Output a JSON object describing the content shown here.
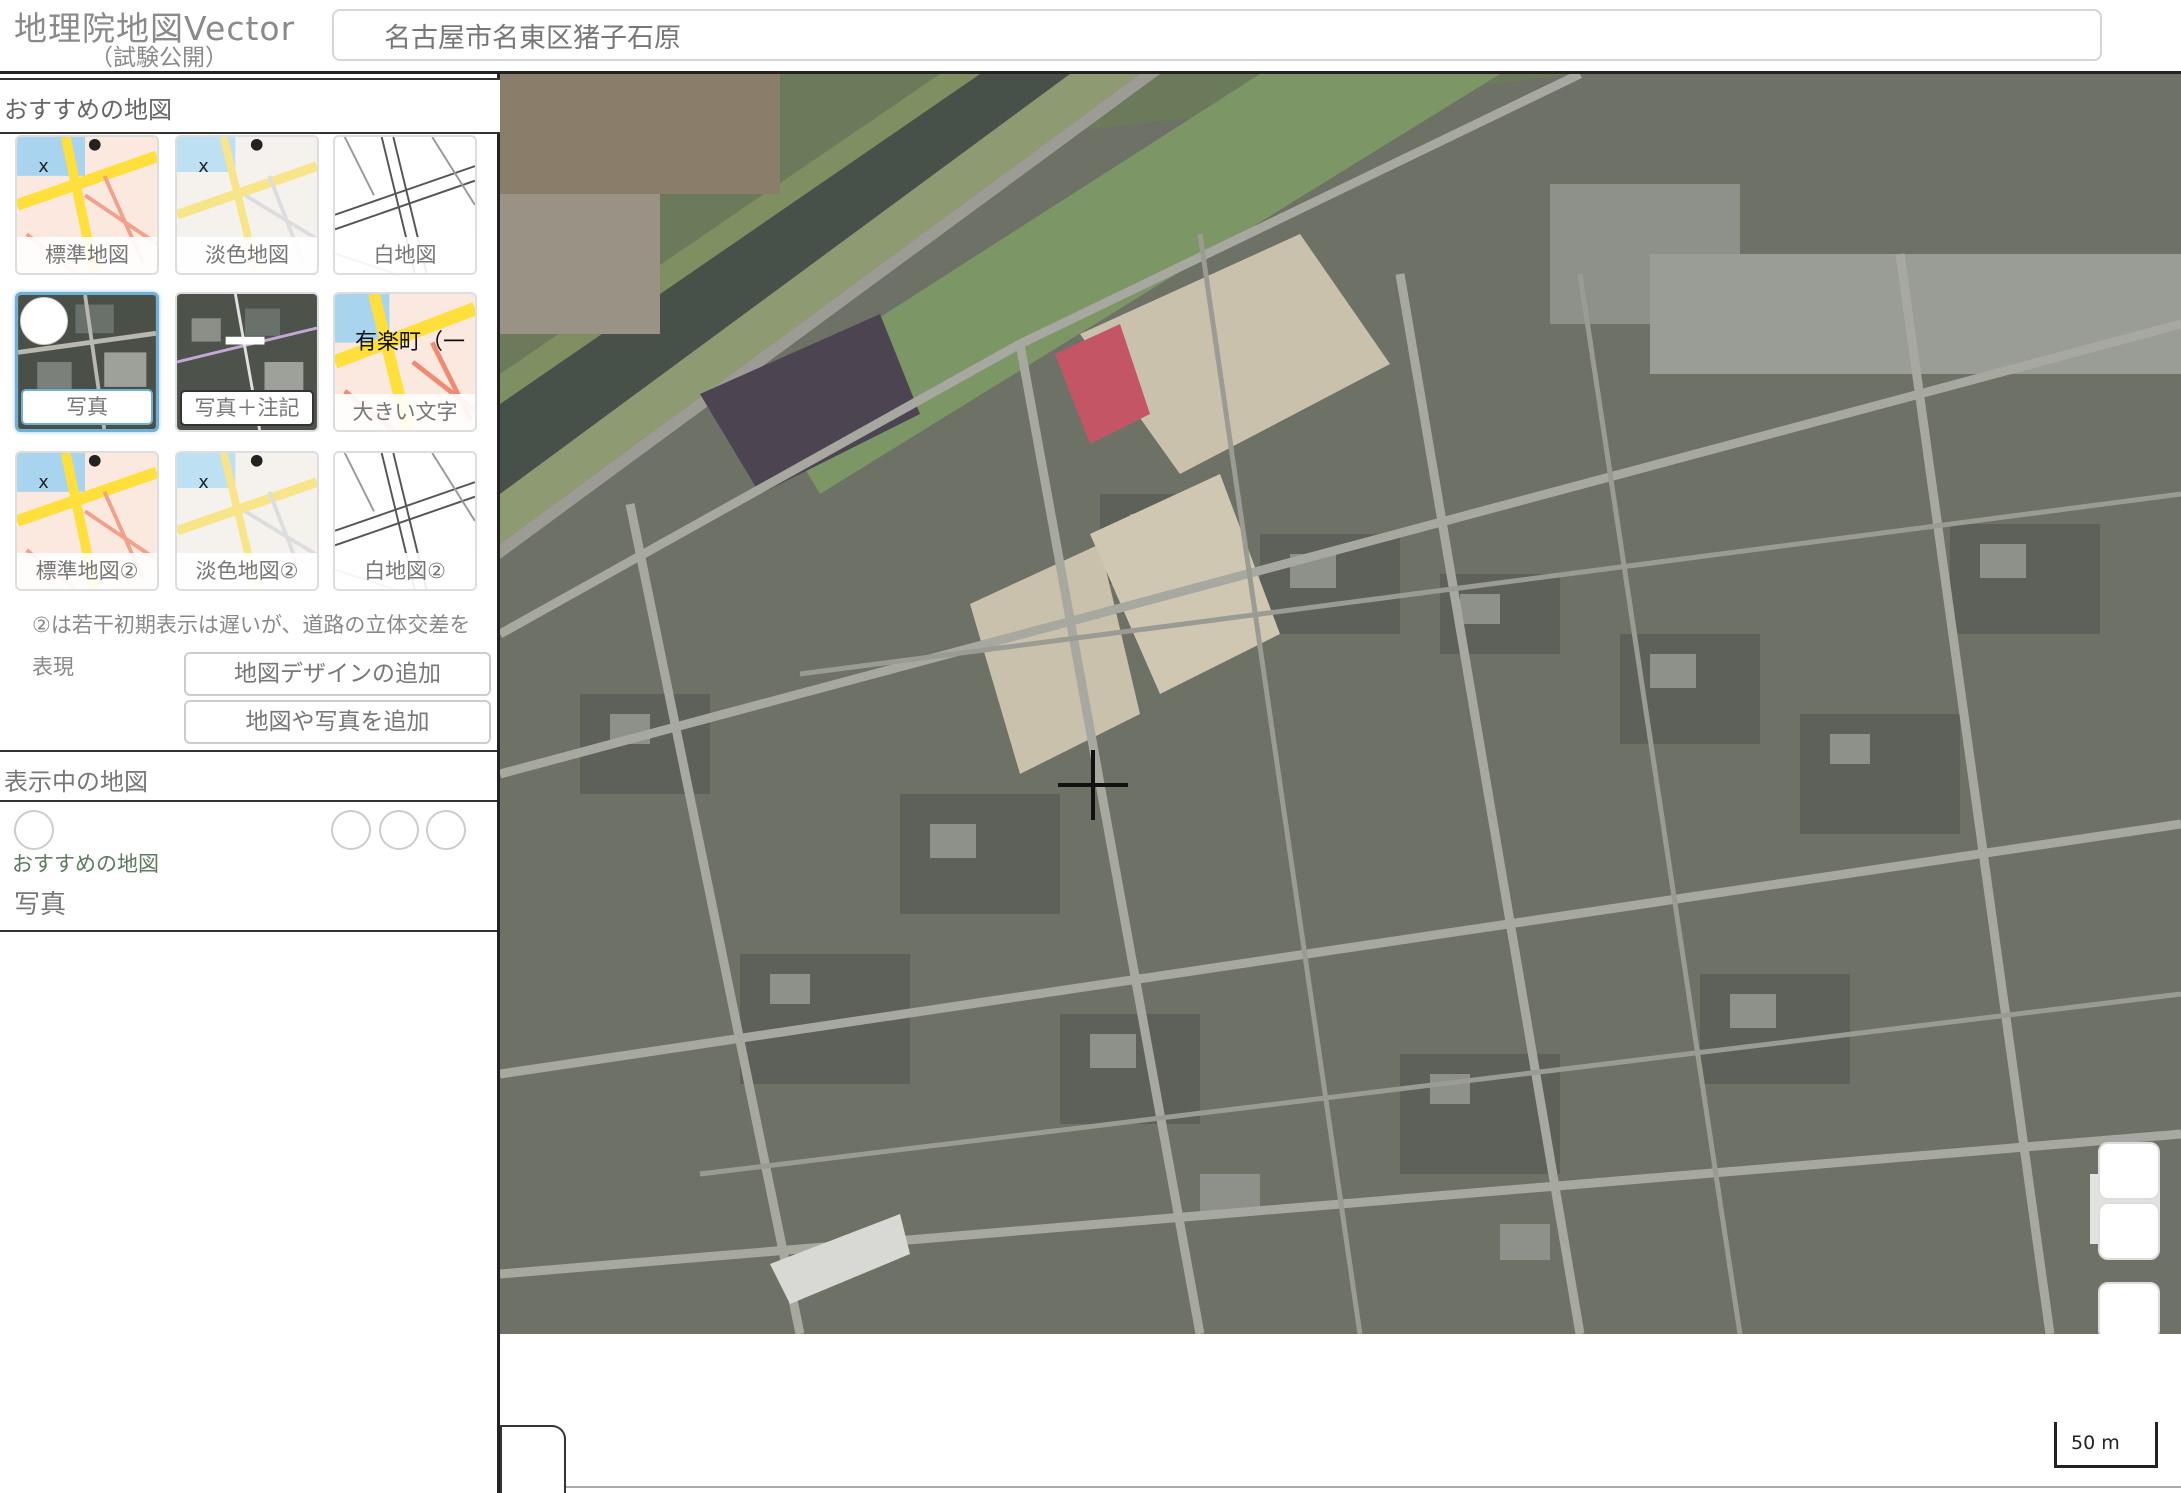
{
  "header": {
    "title": "地理院地図Vector",
    "subtitle": "（試験公開）",
    "search_value": "名古屋市名東区猪子石原"
  },
  "left_panel": {
    "recommended_header": "おすすめの地図",
    "thumbnails": [
      {
        "label": "標準地図",
        "style": "standard"
      },
      {
        "label": "淡色地図",
        "style": "pale"
      },
      {
        "label": "白地図",
        "style": "blank"
      },
      {
        "label": "写真",
        "style": "photo",
        "selected": true
      },
      {
        "label": "写真＋注記",
        "style": "photo-labels"
      },
      {
        "label": "大きい文字",
        "style": "large-text",
        "overlay_text": "有楽町（一"
      },
      {
        "label": "標準地図②",
        "style": "standard"
      },
      {
        "label": "淡色地図②",
        "style": "pale"
      },
      {
        "label": "白地図②",
        "style": "blank"
      }
    ],
    "note": "②は若干初期表示は遅いが、道路の立体交差を表現",
    "buttons": {
      "add_design": "地図デザインの追加",
      "add_map_photo": "地図や写真を追加"
    },
    "showing_header": "表示中の地図",
    "active_layer": {
      "group": "おすすめの地図",
      "name": "写真"
    }
  },
  "map": {
    "scale_label": "50 m"
  },
  "colors": {
    "accent_border": "#6fb1d6",
    "dark_border": "#222222",
    "map_ground": "#6d7166"
  }
}
